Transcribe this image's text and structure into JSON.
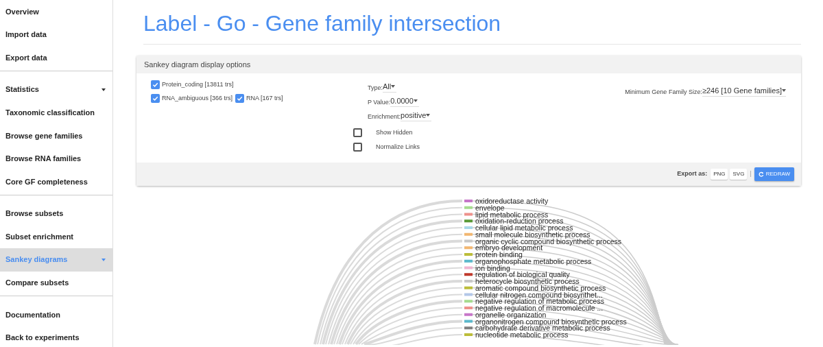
{
  "sidebar": {
    "groups": [
      {
        "items": [
          {
            "label": "Overview",
            "selected": false,
            "expandable": false
          },
          {
            "label": "Import data",
            "selected": false,
            "expandable": false
          },
          {
            "label": "Export data",
            "selected": false,
            "expandable": false
          }
        ]
      },
      {
        "items": [
          {
            "label": "Statistics",
            "selected": false,
            "expandable": true
          },
          {
            "label": "Taxonomic classification",
            "selected": false,
            "expandable": false
          },
          {
            "label": "Browse gene families",
            "selected": false,
            "expandable": false
          },
          {
            "label": "Browse RNA families",
            "selected": false,
            "expandable": false
          },
          {
            "label": "Core GF completeness",
            "selected": false,
            "expandable": false
          }
        ]
      },
      {
        "items": [
          {
            "label": "Browse subsets",
            "selected": false,
            "expandable": false
          },
          {
            "label": "Subset enrichment",
            "selected": false,
            "expandable": false
          },
          {
            "label": "Sankey diagrams",
            "selected": true,
            "expandable": true
          },
          {
            "label": "Compare subsets",
            "selected": false,
            "expandable": false
          }
        ]
      },
      {
        "items": [
          {
            "label": "Documentation",
            "selected": false,
            "expandable": false
          },
          {
            "label": "Back to experiments",
            "selected": false,
            "expandable": false
          }
        ]
      }
    ]
  },
  "title": "Label - Go - Gene family intersection",
  "options_panel": {
    "title": "Sankey diagram display options",
    "label_rows": [
      [
        {
          "label": "Protein_coding [13811 trs]",
          "checked": true
        }
      ],
      [
        {
          "label": "RNA_ambiguous [366 trs]",
          "checked": true
        },
        {
          "label": "RNA [167 trs]",
          "checked": true
        }
      ]
    ],
    "selects": [
      {
        "label": "Type:",
        "value": "All"
      },
      {
        "label": "P Value:",
        "value": "0.0000"
      },
      {
        "label": "Enrichment:",
        "value": "positive"
      }
    ],
    "toggles": [
      {
        "label": "Show Hidden",
        "checked": false
      },
      {
        "label": "Normalize Links",
        "checked": false
      }
    ],
    "min_size": {
      "label": "Minimum Gene Family Size:",
      "value": "≥246 [10 Gene families]"
    },
    "export_label": "Export as:",
    "export_buttons": [
      "PNG",
      "SVG"
    ],
    "separator": "|",
    "redraw_button": "REDRAW"
  },
  "sankey": {
    "nodes": [
      {
        "label": "oxidoreductase activity",
        "color": "#c776c9"
      },
      {
        "label": "envelope",
        "color": "#a6dc8f"
      },
      {
        "label": "lipid metabolic process",
        "color": "#ee928c"
      },
      {
        "label": "oxidation-reduction process",
        "color": "#5a9a38"
      },
      {
        "label": "cellular lipid metabolic process",
        "color": "#a9d8e8"
      },
      {
        "label": "small molecule biosynthetic process",
        "color": "#f2b771"
      },
      {
        "label": "organic cyclic compound biosynthetic process",
        "color": "#c8c8c8"
      },
      {
        "label": "embryo development",
        "color": "#f2b771"
      },
      {
        "label": "protein binding",
        "color": "#bcbd3a"
      },
      {
        "label": "organophosphate metabolic process",
        "color": "#5bb8cc"
      },
      {
        "label": "ion binding",
        "color": "#f0b5d1"
      },
      {
        "label": "regulation of biological quality",
        "color": "#c0392b"
      },
      {
        "label": "heterocycle biosynthetic process",
        "color": "#c8c8c8"
      },
      {
        "label": "aromatic compound biosynthetic process",
        "color": "#bcbd3a"
      },
      {
        "label": "cellular nitrogen compound biosynthet...",
        "color": "#b3c7e8"
      },
      {
        "label": "negative regulation of metabolic process",
        "color": "#a6dc8f"
      },
      {
        "label": "negative regulation of macromolecule ...",
        "color": "#ee928c"
      },
      {
        "label": "organelle organization",
        "color": "#c776c9"
      },
      {
        "label": "organonitrogen compound biosynthetic process",
        "color": "#5bb8cc"
      },
      {
        "label": "carbohydrate derivative metabolic process",
        "color": "#808080"
      },
      {
        "label": "nucleotide metabolic process",
        "color": "#bcbd3a"
      }
    ]
  }
}
